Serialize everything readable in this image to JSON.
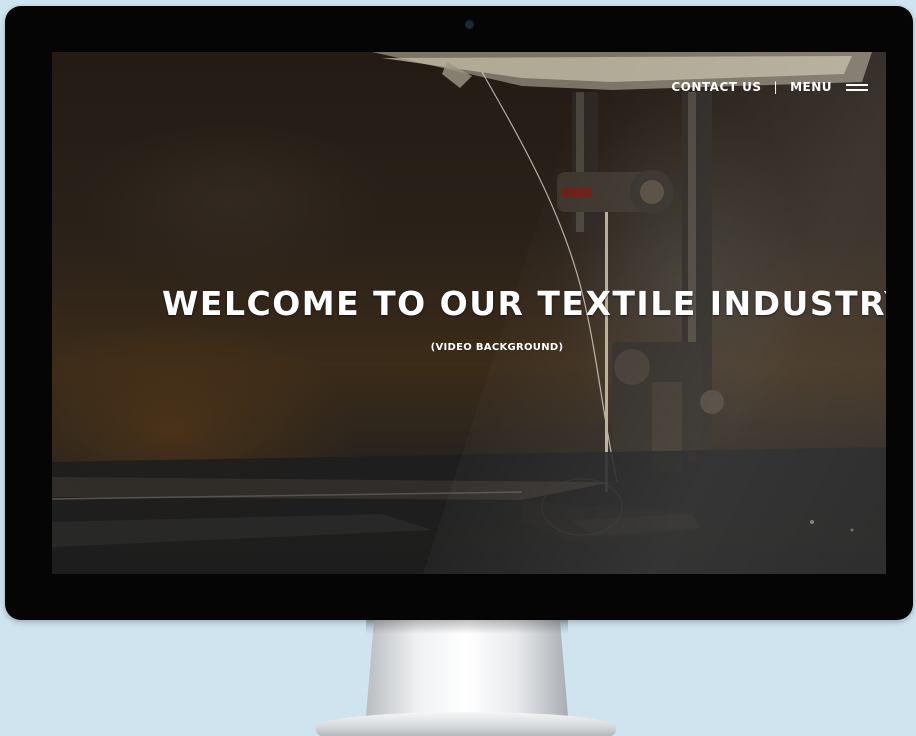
{
  "nav": {
    "contact_label": "CONTACT US",
    "separator": "|",
    "menu_label": "MENU",
    "menu_icon": "hamburger-menu-icon"
  },
  "hero": {
    "title": "WELCOME TO OUR TEXTILE INDUSTRY",
    "subtitle": "(VIDEO BACKGROUND)"
  },
  "colors": {
    "page_background": "#cfe4ef",
    "bezel": "#050505",
    "text": "#ffffff"
  }
}
